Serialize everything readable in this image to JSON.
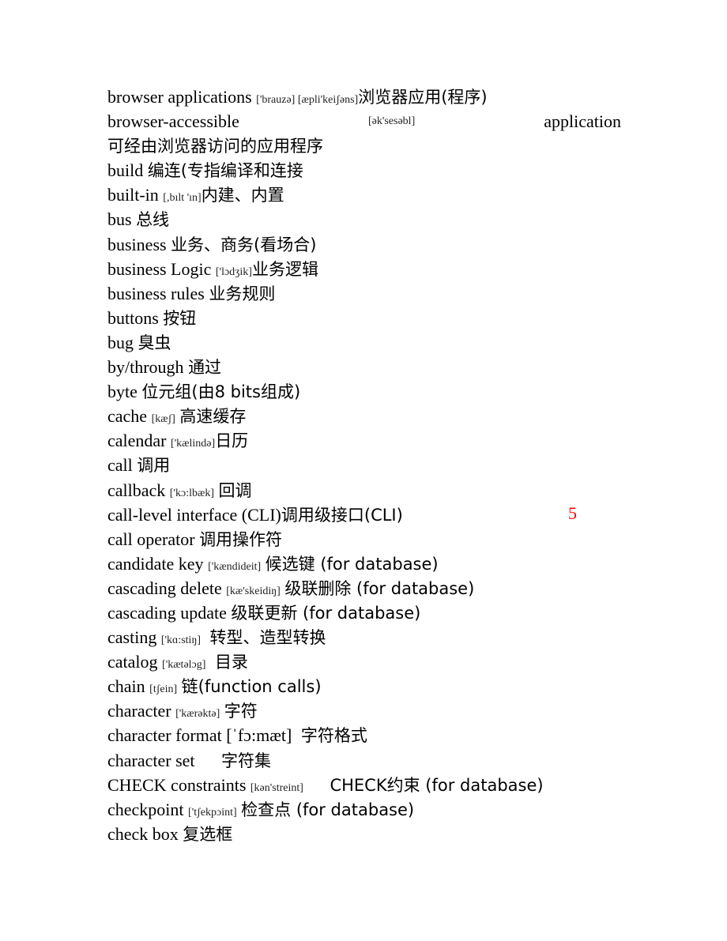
{
  "page_number": "5",
  "page_number_color": "#ff0000",
  "entries": [
    {
      "term": "browser applications",
      "phonetic": "['brauzə] [æpli'keiʃəns]",
      "meaning": "浏览器应用(程序)"
    },
    {
      "term": "browser-accessible",
      "phonetic": "[ək'sesəbl]",
      "term_tail": "application",
      "meaning": "可经由浏览器访问的应用程序"
    },
    {
      "term": "build",
      "meaning": "编连(专指编译和连接"
    },
    {
      "term": "built-in",
      "phonetic": "[,bılt 'ın]",
      "meaning": "内建、内置"
    },
    {
      "term": "bus",
      "meaning": "总线"
    },
    {
      "term": "business",
      "meaning": "业务、商务(看场合)"
    },
    {
      "term": "business Logic",
      "phonetic": "['lɔdʒik]",
      "meaning": "业务逻辑"
    },
    {
      "term": "business rules",
      "meaning": "业务规则"
    },
    {
      "term": "buttons",
      "meaning": "按钮"
    },
    {
      "term": "bug",
      "meaning": "臭虫"
    },
    {
      "term": "by/through",
      "meaning": "通过"
    },
    {
      "term": "byte",
      "meaning": "位元组(由8 bits组成)"
    },
    {
      "term": "cache",
      "phonetic": "[kæʃ]",
      "meaning": "高速缓存"
    },
    {
      "term": "calendar",
      "phonetic": "['kælində]",
      "meaning": "日历"
    },
    {
      "term": "call",
      "meaning": "调用"
    },
    {
      "term": "callback",
      "phonetic": "['kɔ:lbæk]",
      "meaning": "回调"
    },
    {
      "term": "call-level interface (CLI)",
      "meaning": "调用级接口(CLI)"
    },
    {
      "term": "call operator",
      "meaning": "调用操作符"
    },
    {
      "term": "candidate key",
      "phonetic": "['kændideit]",
      "meaning": "候选键 (for database)"
    },
    {
      "term": "cascading delete",
      "phonetic": "[kæ'skeidiŋ]",
      "meaning": "级联删除 (for database)"
    },
    {
      "term": "cascading update",
      "meaning": "级联更新 (for database)"
    },
    {
      "term": "casting",
      "phonetic": "['kɑ:stiŋ]",
      "meaning": "转型、造型转换"
    },
    {
      "term": "catalog",
      "phonetic": "['kætəlɔg]",
      "meaning": "目录"
    },
    {
      "term": "chain",
      "phonetic": "[tʃein]",
      "meaning": "链(function calls)"
    },
    {
      "term": "character",
      "phonetic": "['kærəktə]",
      "meaning": "字符"
    },
    {
      "term": "character format",
      "phonetic": "[ˈfɔ:mæt]",
      "meaning": "字符格式"
    },
    {
      "term": "character set",
      "meaning": "字符集"
    },
    {
      "term": "CHECK constraints",
      "phonetic": "[kən'streint]",
      "meaning": "CHECK约束 (for database)"
    },
    {
      "term": "checkpoint",
      "phonetic": "['tʃekpɔint]",
      "meaning": "检查点 (for database)"
    },
    {
      "term": "check box",
      "meaning": "复选框"
    }
  ]
}
